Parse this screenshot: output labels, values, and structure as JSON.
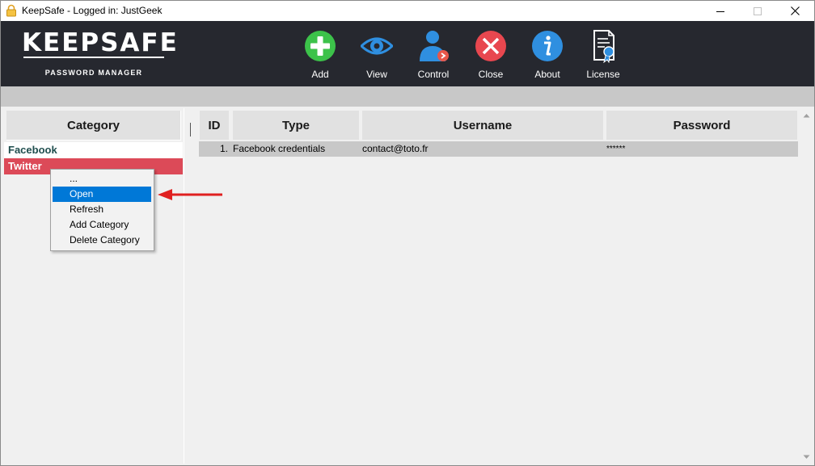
{
  "window": {
    "title": "KeepSafe - Logged in: JustGeek"
  },
  "brand": {
    "title": "KEEPSAFE",
    "subtitle": "PASSWORD MANAGER"
  },
  "toolbar": [
    {
      "label": "Add",
      "icon": "plus-circle-icon",
      "color": "#3cc24a"
    },
    {
      "label": "View",
      "icon": "eye-icon",
      "color": "#2f8fe0"
    },
    {
      "label": "Control",
      "icon": "user-control-icon",
      "color": "#2f8fe0"
    },
    {
      "label": "Close",
      "icon": "close-circle-icon",
      "color": "#e8474f"
    },
    {
      "label": "About",
      "icon": "info-circle-icon",
      "color": "#2f8fe0"
    },
    {
      "label": "License",
      "icon": "certificate-icon",
      "color": "#ffffff"
    }
  ],
  "categories": {
    "header": "Category",
    "items": [
      {
        "label": "Facebook",
        "selected": false
      },
      {
        "label": "Twitter",
        "selected": true,
        "color": "#dc4a58"
      }
    ]
  },
  "grid": {
    "columns": [
      "ID",
      "Type",
      "Username",
      "Password"
    ],
    "rows": [
      {
        "id": "1.",
        "type": "Facebook credentials",
        "username": "contact@toto.fr",
        "password": "******"
      }
    ]
  },
  "context_menu": {
    "items": [
      {
        "label": "..."
      },
      {
        "label": "Open",
        "highlighted": true
      },
      {
        "label": "Refresh"
      },
      {
        "label": "Add Category"
      },
      {
        "label": "Delete Category"
      }
    ]
  },
  "colors": {
    "header_bg": "#26282f",
    "selection": "#0078d7",
    "annotation_arrow": "#e02020"
  }
}
